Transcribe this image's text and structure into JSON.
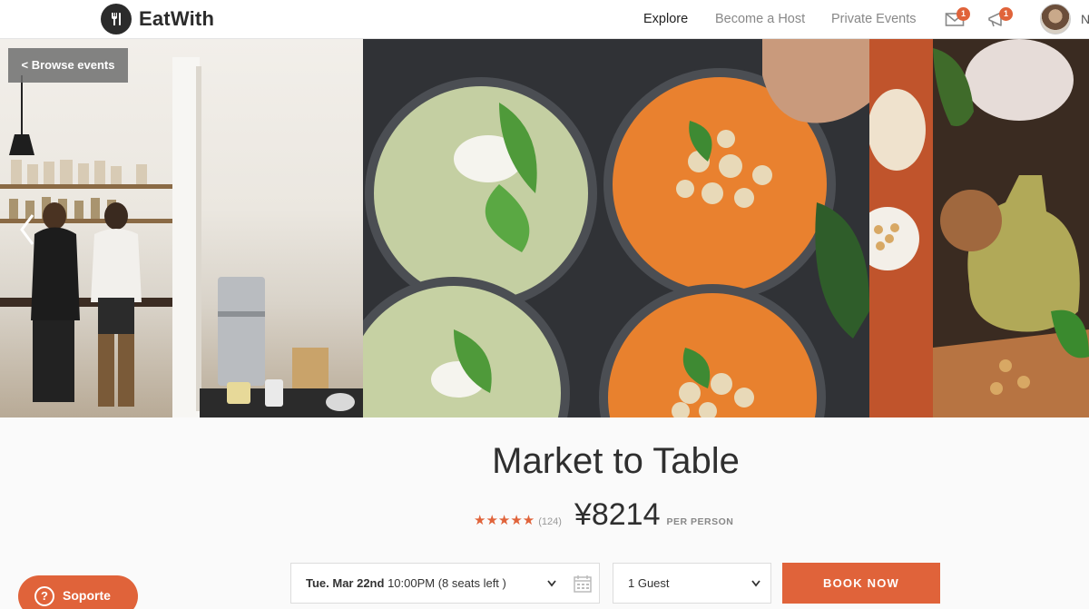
{
  "header": {
    "logo_text": "EatWith",
    "nav": {
      "explore": "Explore",
      "become_host": "Become a Host",
      "private_events": "Private Events"
    },
    "messages_badge": "1",
    "notifications_badge": "1",
    "user_initial": "N"
  },
  "hero": {
    "browse_label": "< Browse events"
  },
  "event": {
    "title": "Market to Table",
    "stars": "★★★★★",
    "review_count": "(124)",
    "price": "¥8214",
    "price_unit": "PER PERSON"
  },
  "booking": {
    "date_day": "Tue. Mar 22nd",
    "date_detail": "10:00PM (8 seats left )",
    "guests": "1 Guest",
    "book_label": "BOOK NOW"
  },
  "support": {
    "icon_glyph": "?",
    "label": "Soporte"
  },
  "colors": {
    "accent": "#e0633a",
    "text": "#2f2f2f"
  }
}
